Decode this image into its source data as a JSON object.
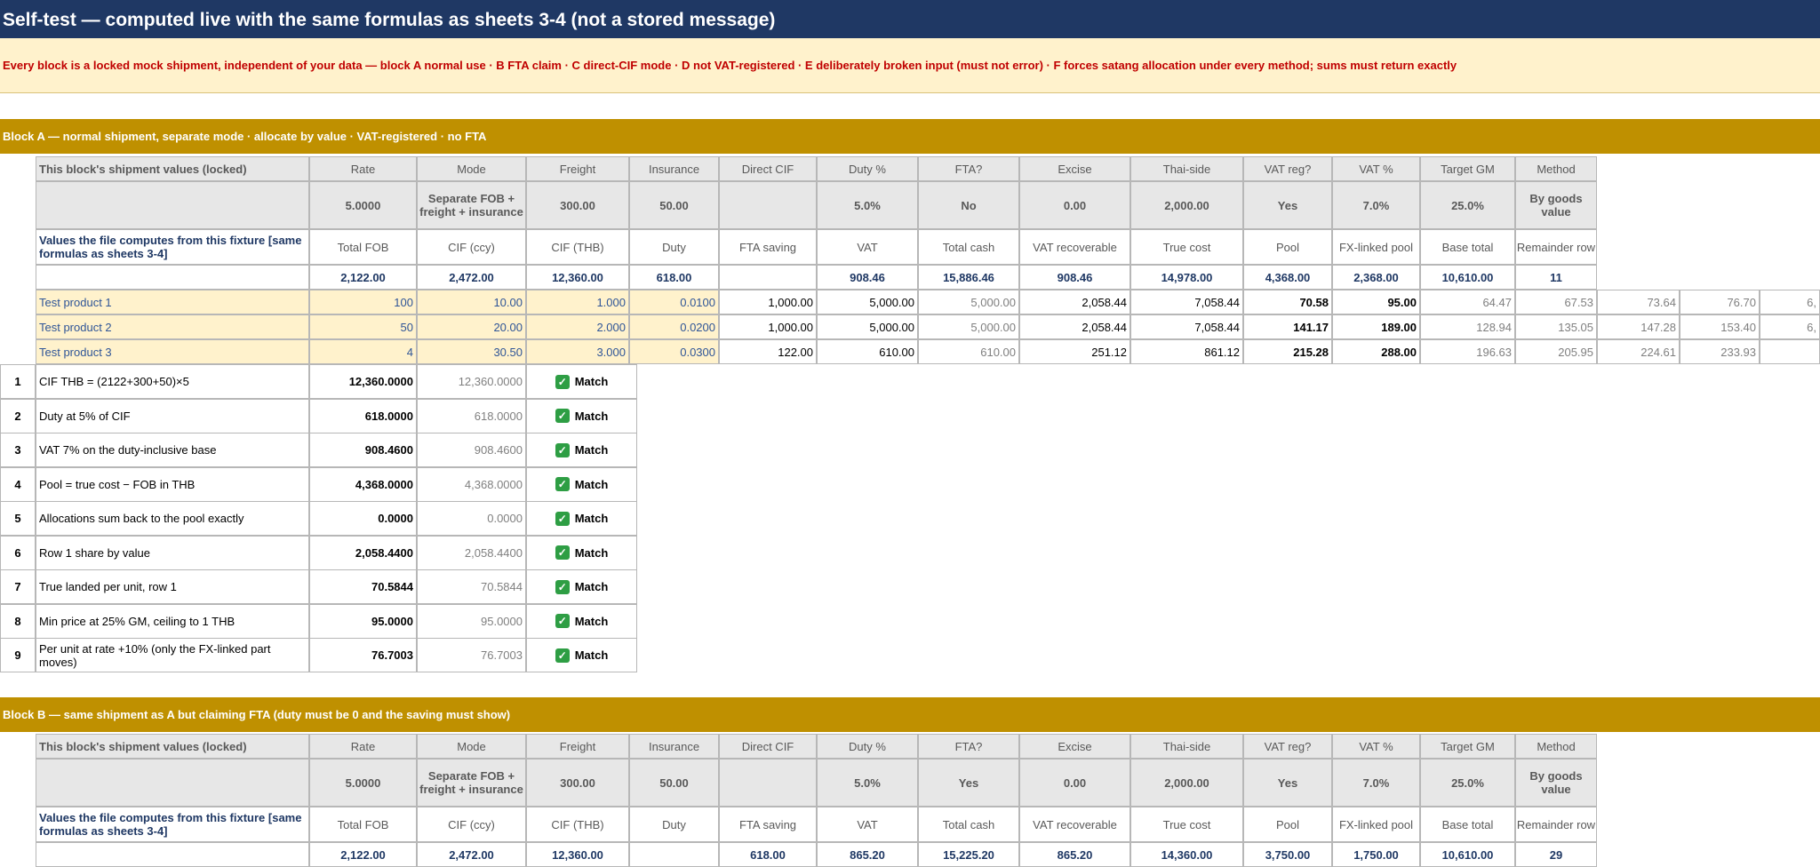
{
  "title": "Self-test — computed live with the same formulas as sheets 3-4 (not a stored message)",
  "notice": "Every block is a locked mock shipment, independent of your data — block A normal use · B FTA claim · C direct-CIF mode · D not VAT-registered · E deliberately broken input (must not error) · F forces satang allocation under every method; sums must return exactly",
  "headers": {
    "locked_label": "This block's shipment values (locked)",
    "input_cols": [
      "Rate",
      "Mode",
      "Freight",
      "Insurance",
      "Direct CIF",
      "Duty %",
      "FTA?",
      "Excise",
      "Thai-side",
      "VAT reg?",
      "VAT %",
      "Target GM",
      "Method"
    ],
    "computed_label": "Values the file computes from this fixture [same formulas as sheets 3-4]",
    "computed_cols": [
      "Total FOB",
      "CIF (ccy)",
      "CIF (THB)",
      "Duty",
      "FTA saving",
      "VAT",
      "Total cash",
      "VAT recoverable",
      "True cost",
      "Pool",
      "FX-linked pool",
      "Base total",
      "Remainder row"
    ]
  },
  "blockA": {
    "title": "Block A — normal shipment, separate mode · allocate by value · VAT-registered · no FTA",
    "inputs": [
      "5.0000",
      "Separate FOB + freight + insurance",
      "300.00",
      "50.00",
      "",
      "5.0%",
      "No",
      "0.00",
      "2,000.00",
      "Yes",
      "7.0%",
      "25.0%",
      "By goods value"
    ],
    "computed": [
      "2,122.00",
      "2,472.00",
      "12,360.00",
      "618.00",
      "",
      "908.46",
      "15,886.46",
      "908.46",
      "14,978.00",
      "4,368.00",
      "2,368.00",
      "10,610.00",
      "11"
    ],
    "products": [
      {
        "name": "Test product 1",
        "qty": "100",
        "fob": "10.00",
        "w1": "1.000",
        "w2": "0.0100",
        "v": [
          "1,000.00",
          "5,000.00",
          "5,000.00",
          "2,058.44",
          "7,058.44",
          "70.58",
          "95.00",
          "64.47",
          "67.53",
          "73.64",
          "76.70",
          "6,"
        ]
      },
      {
        "name": "Test product 2",
        "qty": "50",
        "fob": "20.00",
        "w1": "2.000",
        "w2": "0.0200",
        "v": [
          "1,000.00",
          "5,000.00",
          "5,000.00",
          "2,058.44",
          "7,058.44",
          "141.17",
          "189.00",
          "128.94",
          "135.05",
          "147.28",
          "153.40",
          "6,"
        ]
      },
      {
        "name": "Test product 3",
        "qty": "4",
        "fob": "30.50",
        "w1": "3.000",
        "w2": "0.0300",
        "v": [
          "122.00",
          "610.00",
          "610.00",
          "251.12",
          "861.12",
          "215.28",
          "288.00",
          "196.63",
          "205.95",
          "224.61",
          "233.93",
          ""
        ]
      }
    ],
    "checks": [
      {
        "no": "1",
        "desc": "CIF THB = (2122+300+50)×5",
        "expected": "12,360.0000",
        "got": "12,360.0000",
        "result": "Match"
      },
      {
        "no": "2",
        "desc": "Duty at 5% of CIF",
        "expected": "618.0000",
        "got": "618.0000",
        "result": "Match"
      },
      {
        "no": "3",
        "desc": "VAT 7% on the duty-inclusive base",
        "expected": "908.4600",
        "got": "908.4600",
        "result": "Match"
      },
      {
        "no": "4",
        "desc": "Pool = true cost − FOB in THB",
        "expected": "4,368.0000",
        "got": "4,368.0000",
        "result": "Match"
      },
      {
        "no": "5",
        "desc": "Allocations sum back to the pool exactly",
        "expected": "0.0000",
        "got": "0.0000",
        "result": "Match"
      },
      {
        "no": "6",
        "desc": "Row 1 share by value",
        "expected": "2,058.4400",
        "got": "2,058.4400",
        "result": "Match"
      },
      {
        "no": "7",
        "desc": "True landed per unit, row 1",
        "expected": "70.5844",
        "got": "70.5844",
        "result": "Match"
      },
      {
        "no": "8",
        "desc": "Min price at 25% GM, ceiling to 1 THB",
        "expected": "95.0000",
        "got": "95.0000",
        "result": "Match"
      },
      {
        "no": "9",
        "desc": "Per unit at rate +10% (only the FX-linked part moves)",
        "expected": "76.7003",
        "got": "76.7003",
        "result": "Match"
      }
    ]
  },
  "blockB": {
    "title": "Block B — same shipment as A but claiming FTA (duty must be 0 and the saving must show)",
    "inputs": [
      "5.0000",
      "Separate FOB + freight + insurance",
      "300.00",
      "50.00",
      "",
      "5.0%",
      "Yes",
      "0.00",
      "2,000.00",
      "Yes",
      "7.0%",
      "25.0%",
      "By goods value"
    ],
    "computed": [
      "2,122.00",
      "2,472.00",
      "12,360.00",
      "",
      "618.00",
      "865.20",
      "15,225.20",
      "865.20",
      "14,360.00",
      "3,750.00",
      "1,750.00",
      "10,610.00",
      "29"
    ]
  },
  "icons": {
    "result": "check-mark-icon"
  },
  "colors": {
    "title_bg": "#1f3864",
    "notice_bg": "#fff2cc",
    "notice_text": "#c00000",
    "block_bg": "#bf9000",
    "product_bg": "#fff2cc",
    "match_green": "#2e9e44"
  }
}
